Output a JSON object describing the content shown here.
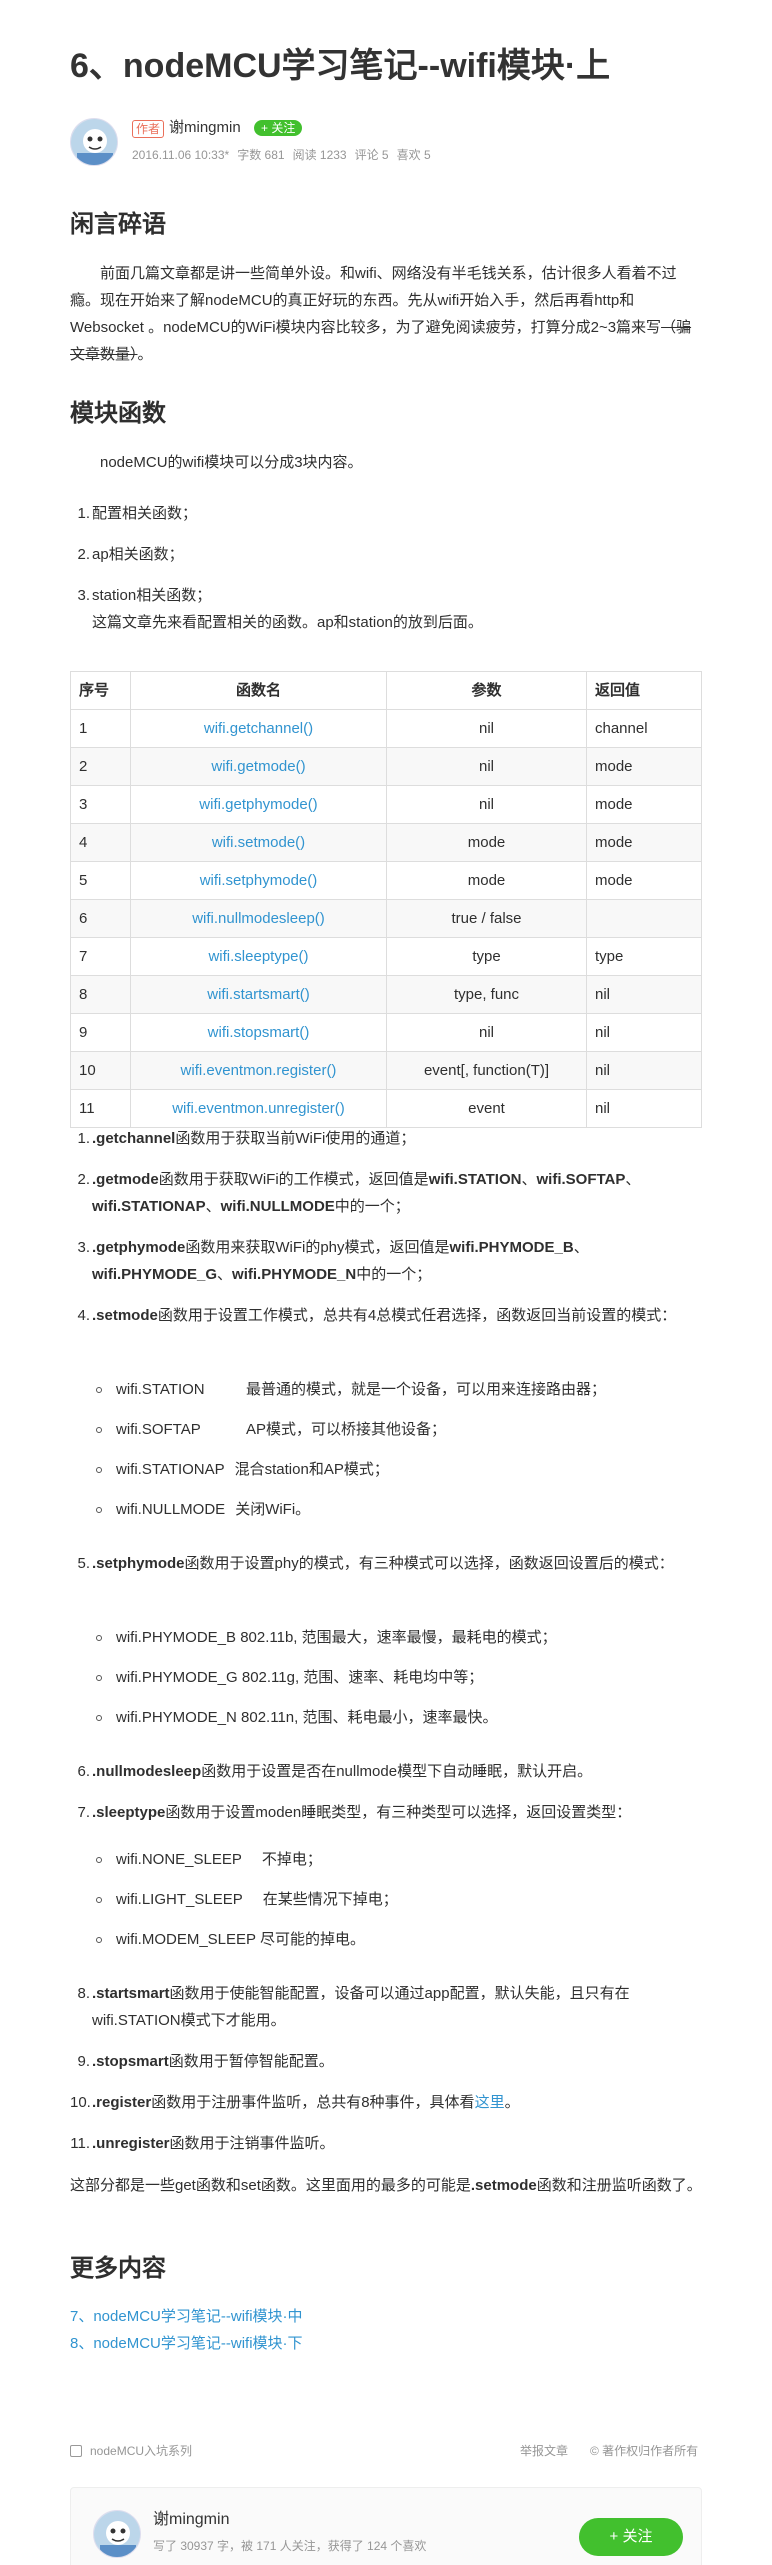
{
  "article": {
    "title": "6、nodeMCU学习笔记--wifi模块·上",
    "author": {
      "badge": "作者",
      "name": "谢mingmin",
      "follow_label": "+ 关注",
      "date": "2016.11.06 10:33*",
      "word_count": "字数 681",
      "reads": "阅读 1233",
      "comments": "评论 5",
      "likes": "喜欢 5"
    },
    "section1": {
      "heading": "闲言碎语",
      "text_main": "前面几篇文章都是讲一些简单外设。和wifi、网络没有半毛钱关系，估计很多人看着不过瘾。现在开始来了解nodeMCU的真正好玩的东西。先从wifi开始入手，然后再看http和Websocket 。nodeMCU的WiFi模块内容比较多，为了避免阅读疲劳，打算分成2~3篇来写",
      "text_strike": "（骗文章数量）",
      "text_end": "。"
    },
    "section2": {
      "heading": "模块函数",
      "intro": "nodeMCU的wifi模块可以分成3块内容。",
      "parts": [
        "配置相关函数；",
        "ap相关函数；",
        "station相关函数；"
      ],
      "note": "这篇文章先来看配置相关的函数。ap和station的放到后面。"
    },
    "table": {
      "headers": [
        "序号",
        "函数名",
        "参数",
        "返回值"
      ],
      "rows": [
        [
          "1",
          "wifi.getchannel()",
          "nil",
          "channel"
        ],
        [
          "2",
          "wifi.getmode()",
          "nil",
          "mode"
        ],
        [
          "3",
          "wifi.getphymode()",
          "nil",
          "mode"
        ],
        [
          "4",
          "wifi.setmode()",
          "mode",
          "mode"
        ],
        [
          "5",
          "wifi.setphymode()",
          "mode",
          "mode"
        ],
        [
          "6",
          "wifi.nullmodesleep()",
          "true / false",
          ""
        ],
        [
          "7",
          "wifi.sleeptype()",
          "type",
          "type"
        ],
        [
          "8",
          "wifi.startsmart()",
          "type, func",
          "nil"
        ],
        [
          "9",
          "wifi.stopsmart()",
          "nil",
          "nil"
        ],
        [
          "10",
          "wifi.eventmon.register()",
          "event[, function(T)]",
          "nil"
        ],
        [
          "11",
          "wifi.eventmon.unregister()",
          "event",
          "nil"
        ]
      ]
    },
    "details": {
      "d1": {
        "fn": ".getchannel",
        "text": "函数用于获取当前WiFi使用的通道；"
      },
      "d2": {
        "fn": ".getmode",
        "text_a": "函数用于获取WiFi的工作模式，返回值是",
        "b1": "wifi.STATION",
        "sep1": "、",
        "b2": "wifi.SOFTAP",
        "sep2": "、",
        "b3": "wifi.STATIONAP",
        "sep3": "、",
        "b4": "wifi.NULLMODE",
        "text_b": "中的一个；"
      },
      "d3": {
        "fn": ".getphymode",
        "text_a": "函数用来获取WiFi的phy模式，返回值是",
        "b1": "wifi.PHYMODE_B",
        "sep1": "、",
        "b2": "wifi.PHYMODE_G",
        "sep2": "、",
        "b3": "wifi.PHYMODE_N",
        "text_b": "中的一个；"
      },
      "d4": {
        "fn": ".setmode",
        "text": "函数用于设置工作模式，总共有4总模式任君选择，函数返回当前设置的模式：",
        "items": [
          {
            "name": "wifi.STATION",
            "desc": "最普通的模式，就是一个设备，可以用来连接路由器；"
          },
          {
            "name": "wifi.SOFTAP",
            "desc": "AP模式，可以桥接其他设备；"
          },
          {
            "name": "wifi.STATIONAP",
            "desc": "混合station和AP模式；"
          },
          {
            "name": "wifi.NULLMODE",
            "desc": "关闭WiFi。"
          }
        ]
      },
      "d5": {
        "fn": ".setphymode",
        "text": "函数用于设置phy的模式，有三种模式可以选择，函数返回设置后的模式：",
        "items": [
          "wifi.PHYMODE_B 802.11b, 范围最大，速率最慢，最耗电的模式；",
          "wifi.PHYMODE_G 802.11g, 范围、速率、耗电均中等；",
          "wifi.PHYMODE_N 802.11n, 范围、耗电最小，速率最快。"
        ]
      },
      "d6": {
        "fn": ".nullmodesleep",
        "text": "函数用于设置是否在nullmode模型下自动睡眠，默认开启。"
      },
      "d7": {
        "fn": ".sleeptype",
        "text": "函数用于设置moden睡眠类型，有三种类型可以选择，返回设置类型：",
        "items": [
          {
            "name": "wifi.NONE_SLEEP",
            "desc": "不掉电；"
          },
          {
            "name": "wifi.LIGHT_SLEEP",
            "desc": "在某些情况下掉电；"
          },
          {
            "name": "wifi.MODEM_SLEEP",
            "desc": "尽可能的掉电。"
          }
        ]
      },
      "d8": {
        "fn": ".startsmart",
        "text": "函数用于使能智能配置，设备可以通过app配置，默认失能，且只有在wifi.STATION模式下才能用。"
      },
      "d9": {
        "fn": ".stopsmart",
        "text": "函数用于暂停智能配置。"
      },
      "d10": {
        "fn": ".register",
        "text": "函数用于注册事件监听，总共有8种事件，具体看",
        "link": "这里",
        "end": "。"
      },
      "d11": {
        "fn": ".unregister",
        "text": "函数用于注销事件监听。"
      }
    },
    "summary": {
      "text_a": "这部分都是一些get函数和set函数。这里面用的最多的可能是",
      "bold": ".setmode",
      "text_b": "函数和注册监听函数了。"
    },
    "more": {
      "heading": "更多内容",
      "links": [
        "7、nodeMCU学习笔记--wifi模块·中",
        "8、nodeMCU学习笔记--wifi模块·下"
      ]
    },
    "footer": {
      "series": "nodeMCU入坑系列",
      "report": "举报文章",
      "copyright": "© 著作权归作者所有"
    },
    "author_card": {
      "name": "谢mingmin",
      "stats": "写了 30937 字，被 171 人关注，获得了 124 个喜欢",
      "follow_label": "+ 关注"
    }
  },
  "colors": {
    "accent": "#3194d0",
    "follow": "#42c02e",
    "badge": "#ea6f5a"
  }
}
